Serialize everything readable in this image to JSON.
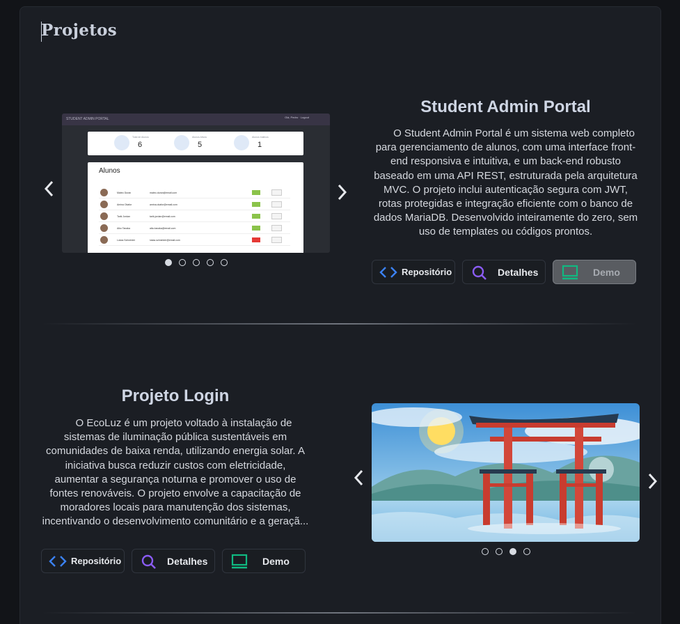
{
  "section": {
    "title": "Projetos"
  },
  "projects": [
    {
      "title": "Student Admin Portal",
      "description": "O Student Admin Portal é um sistema web completo para gerenciamento de alunos, com uma interface front-end responsiva e intuitiva, e um back-end robusto baseado em uma API REST, estruturada pela arquitetura MVC. O projeto inclui autenticação segura com JWT, rotas protegidas e integração eficiente com o banco de dados MariaDB. Desenvolvido inteiramente do zero, sem uso de templates ou códigos prontos.",
      "buttons": {
        "repo": "Repositório",
        "details": "Detalhes",
        "demo": "Demo"
      },
      "carousel": {
        "slides": 5,
        "active": 0
      },
      "screenshot": {
        "app_title": "STUDENT ADMIN PORTAL",
        "user": "Olá, Pedro · Logout",
        "stats": [
          {
            "label": "Total de Alunos",
            "value": "6"
          },
          {
            "label": "Alunos Ativos",
            "value": "5"
          },
          {
            "label": "Alunos Inativos",
            "value": "1"
          }
        ],
        "table_title": "Alunos",
        "rows": [
          {
            "name": "Mateo Duran",
            "email": "mateo.duran@email.com"
          },
          {
            "name": "Amina Okafor",
            "email": "amina.okafor@email.com"
          },
          {
            "name": "Tarik Jordan",
            "email": "tarik.jordan@email.com"
          },
          {
            "name": "Aiko Tanaka",
            "email": "aiko.tanaka@email.com"
          },
          {
            "name": "Lukas Schneider",
            "email": "lukas.schneider@email.com"
          }
        ]
      }
    },
    {
      "title": "Projeto Login",
      "description": "O EcoLuz é um projeto voltado à instalação de sistemas de iluminação pública sustentáveis em comunidades de baixa renda, utilizando energia solar. A iniciativa busca reduzir custos com eletricidade, aumentar a segurança noturna e promover o uso de fontes renováveis. O projeto envolve a capacitação de moradores locais para manutenção dos sistemas, incentivando o desenvolvimento comunitário e a geraçã...",
      "buttons": {
        "repo": "Repositório",
        "details": "Detalhes",
        "demo": "Demo"
      },
      "carousel": {
        "slides": 4,
        "active": 2
      }
    }
  ],
  "colors": {
    "background": "#121418",
    "panel": "#1b1e24",
    "code_icon": "#3b82f6",
    "search_icon": "#8b5cf6",
    "monitor_icon": "#10b981"
  }
}
